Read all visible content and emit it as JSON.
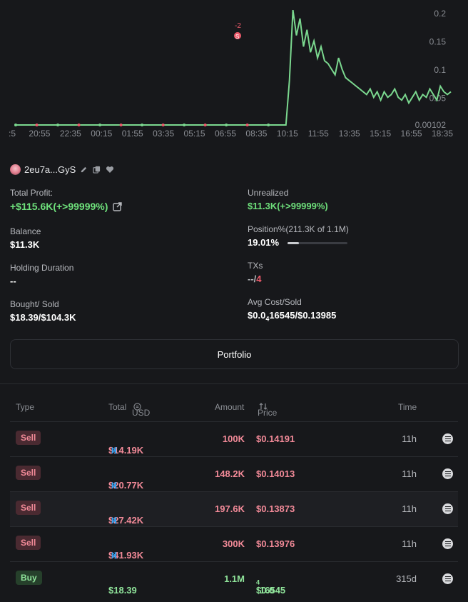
{
  "chart": {
    "y_ticks": [
      "0.2",
      "0.15",
      "0.1",
      "0.05",
      "0.00102"
    ],
    "x_ticks": [
      ":5",
      "20:55",
      "22:35",
      "00:15",
      "01:55",
      "03:35",
      "05:15",
      "06:55",
      "08:35",
      "10:15",
      "11:55",
      "13:35",
      "15:15",
      "16:55",
      "18:35"
    ],
    "line_color": "#7bd88f",
    "marker_label": "S",
    "marker_count": "-2"
  },
  "chart_data": {
    "type": "line",
    "y_ticks": [
      0.2,
      0.15,
      0.1,
      0.05,
      0.00102
    ],
    "series": [
      {
        "values": [
          0.001,
          0.001,
          0.001,
          0.001,
          0.001,
          0.001,
          0.001,
          0.001,
          0.001,
          0.001,
          0.001,
          0.001,
          0.001,
          0.001,
          0.001,
          0.001,
          0.001,
          0.001,
          0.001,
          0.001,
          0.001,
          0.001,
          0.001,
          0.001,
          0.001,
          0.001,
          0.001,
          0.001,
          0.001,
          0.001,
          0.001,
          0.001,
          0.001,
          0.001,
          0.001,
          0.001,
          0.001,
          0.001,
          0.001,
          0.001,
          0.001,
          0.001,
          0.001,
          0.001,
          0.001,
          0.001,
          0.001,
          0.001,
          0.001,
          0.001,
          0.001,
          0.001,
          0.001,
          0.001,
          0.001,
          0.001,
          0.001,
          0.001,
          0.001,
          0.001,
          0.001,
          0.001,
          0.001,
          0.001,
          0.001,
          0.001,
          0.001,
          0.001,
          0.001,
          0.001,
          0.001,
          0.001,
          0.001,
          0.001,
          0.001,
          0.001,
          0.001,
          0.001,
          0.08,
          0.205,
          0.16,
          0.19,
          0.14,
          0.17,
          0.13,
          0.15,
          0.12,
          0.14,
          0.115,
          0.11,
          0.1,
          0.09,
          0.12,
          0.1,
          0.085,
          0.08,
          0.075,
          0.07,
          0.065,
          0.06,
          0.055,
          0.065,
          0.05,
          0.06,
          0.045,
          0.06,
          0.05,
          0.055,
          0.065,
          0.05,
          0.045,
          0.055,
          0.04,
          0.05,
          0.06,
          0.045,
          0.055,
          0.05,
          0.065,
          0.055,
          0.045,
          0.07,
          0.06,
          0.055,
          0.06
        ]
      }
    ]
  },
  "wallet": {
    "name": "2eu7a...GyS"
  },
  "stats": {
    "total_profit_label": "Total Profit:",
    "total_profit_value": "+$115.6K(+>99999%)",
    "unrealized_label": "Unrealized",
    "unrealized_value": "$11.3K(+>99999%)",
    "balance_label": "Balance",
    "balance_value": "$11.3K",
    "position_label": "Position%(211.3K of 1.1M)",
    "position_value": "19.01%",
    "position_fraction": 0.1901,
    "holding_label": "Holding Duration",
    "holding_value": "--",
    "txs_label": "TXs",
    "txs_buys": "--",
    "txs_sep": "/",
    "txs_sells": "4",
    "bought_sold_label": "Bought/ Sold",
    "bought_sold_value": "$18.39/$104.3K",
    "avg_label": "Avg Cost/Sold",
    "avg_prefix": "$0.0",
    "avg_sub": "4",
    "avg_rest": "16545/$0.13985"
  },
  "portfolio_label": "Portfolio",
  "table": {
    "headers": {
      "type": "Type",
      "total": "Total",
      "usd": "USD",
      "amount": "Amount",
      "price": "Price",
      "time": "Time"
    },
    "rows": [
      {
        "type": "Sell",
        "total": "$14.19K",
        "amount": "100K",
        "price": "$0.14191",
        "time": "11h"
      },
      {
        "type": "Sell",
        "total": "$20.77K",
        "amount": "148.2K",
        "price": "$0.14013",
        "time": "11h"
      },
      {
        "type": "Sell",
        "total": "$27.42K",
        "amount": "197.6K",
        "price": "$0.13873",
        "time": "11h"
      },
      {
        "type": "Sell",
        "total": "$41.93K",
        "amount": "300K",
        "price": "$0.13976",
        "time": "11h"
      },
      {
        "type": "Buy",
        "total": "$18.39",
        "amount": "1.1M",
        "price_prefix": "$0.0",
        "price_sub": "4",
        "price_rest": "16545",
        "time": "315d"
      }
    ]
  }
}
